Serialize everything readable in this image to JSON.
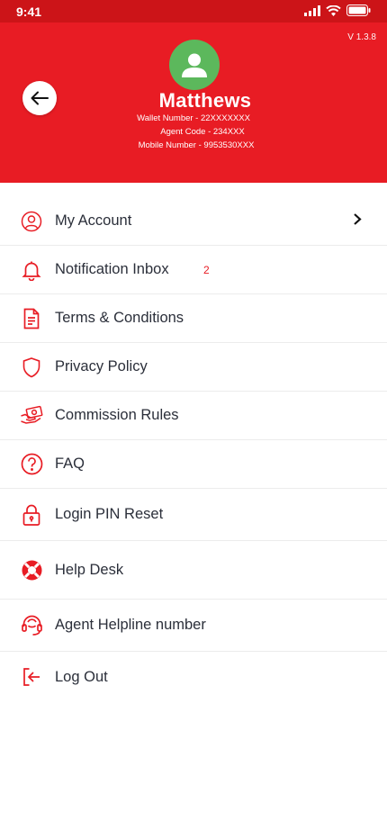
{
  "status_bar": {
    "time": "9:41"
  },
  "header": {
    "version": "V 1.3.8",
    "name": "Matthews",
    "wallet_number": "Wallet Number - 22XXXXXXX",
    "agent_code": "Agent Code - 234XXX",
    "mobile_number": "Mobile Number - 9953530XXX"
  },
  "colors": {
    "brand_red": "#e81c24",
    "avatar_green": "#5cb85c"
  },
  "menu": {
    "items": [
      {
        "label": "My Account",
        "icon": "user-circle-icon"
      },
      {
        "label": "Notification Inbox",
        "icon": "bell-icon",
        "badge": "2"
      },
      {
        "label": "Terms & Conditions",
        "icon": "document-icon"
      },
      {
        "label": "Privacy Policy",
        "icon": "shield-icon"
      },
      {
        "label": "Commission Rules",
        "icon": "cash-hand-icon"
      },
      {
        "label": "FAQ",
        "icon": "question-icon"
      },
      {
        "label": "Login PIN Reset",
        "icon": "lock-icon"
      },
      {
        "label": "Help Desk",
        "icon": "lifebuoy-icon"
      },
      {
        "label": "Agent Helpline number",
        "icon": "headset-icon"
      },
      {
        "label": "Log Out",
        "icon": "logout-icon"
      }
    ]
  }
}
